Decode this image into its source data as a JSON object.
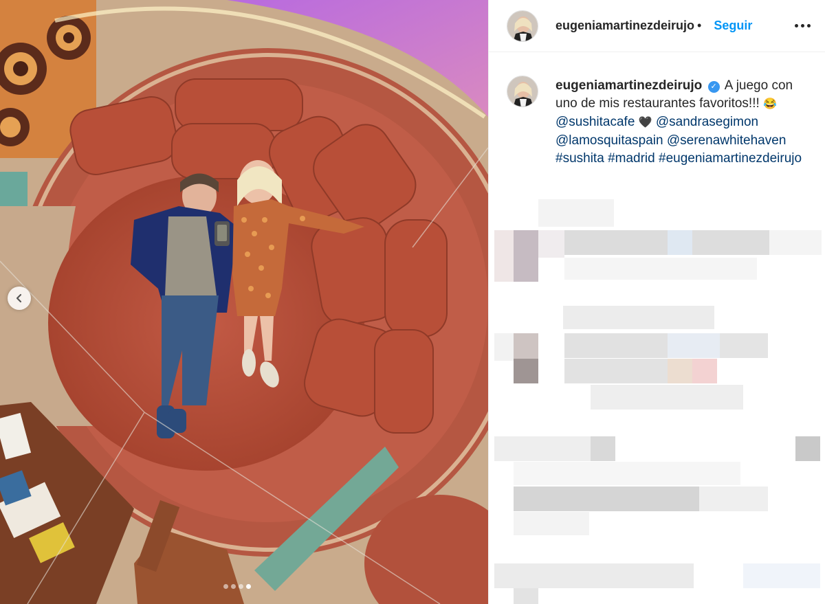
{
  "post": {
    "username": "eugeniamartinezdeirujo",
    "separator": "•",
    "follow_label": "Seguir",
    "caption": {
      "text1": "A juego con uno de mis restaurantes favoritos!!!",
      "emoji": "😂",
      "mention1": "@sushitacafe",
      "heart": "🖤",
      "mention2": "@sandrasegimon",
      "mention3": "@lamosquitaspain",
      "mention4": "@serenawhitehaven",
      "hashtag1": "#sushita",
      "hashtag2": "#madrid",
      "hashtag3": "#eugeniamartinezdeirujo"
    }
  },
  "carousel": {
    "total": 4,
    "active_index": 3
  },
  "icons": {
    "prev": "chevron-left-icon",
    "more": "more-options-icon",
    "verified": "verified-badge-icon"
  },
  "colors": {
    "link": "#00376b",
    "follow": "#0095f6",
    "verified": "#3897f0",
    "text": "#262626"
  }
}
